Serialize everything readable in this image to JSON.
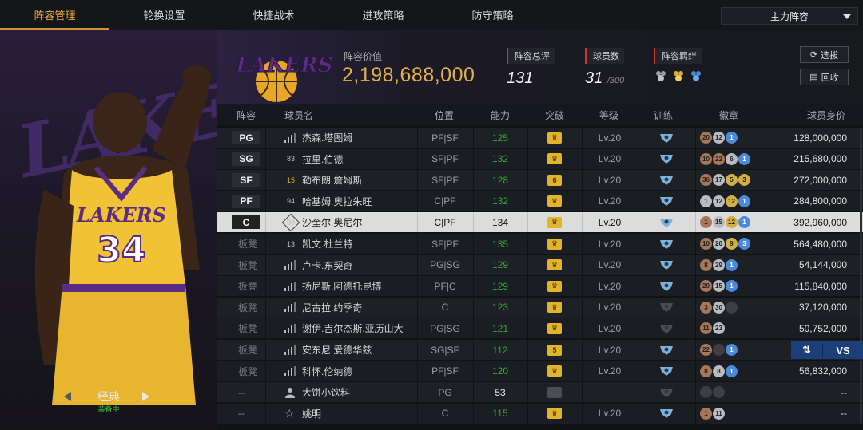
{
  "nav": {
    "tabs": [
      "阵容管理",
      "轮换设置",
      "快捷战术",
      "进攻策略",
      "防守策略"
    ],
    "active_index": 0,
    "lineup_select": "主力阵容"
  },
  "card": {
    "name": "经典",
    "status": "装备中",
    "jersey_team": "LAKERS",
    "jersey_number": "34"
  },
  "summary": {
    "value_label": "阵容价值",
    "value": "2,198,688,000",
    "rating_label": "阵容总评",
    "rating": "131",
    "players_label": "球员数",
    "players": "31",
    "players_max": "/300",
    "bond_label": "阵容羁绊",
    "btn_select": "选拔",
    "btn_recycle": "回收",
    "logo_text": "LAKERS"
  },
  "columns": {
    "lineup": "阵容",
    "name": "球员名",
    "position": "位置",
    "ability": "能力",
    "breakthrough": "突破",
    "level": "等级",
    "training": "训练",
    "badge": "徽章",
    "value": "球员身价"
  },
  "rows": [
    {
      "slot": "PG",
      "icon": "signal",
      "name": "杰森.塔图姆",
      "pos": "PF|SF",
      "ability": "125",
      "crown": "",
      "level": "Lv.20",
      "badges": [
        [
          "b",
          "20"
        ],
        [
          "s",
          "12"
        ],
        [
          "h",
          "1"
        ]
      ],
      "value": "128,000,000"
    },
    {
      "slot": "SG",
      "icon": "83",
      "name": "拉里.伯德",
      "pos": "SF|PF",
      "ability": "132",
      "crown": "",
      "level": "Lv.20",
      "badges": [
        [
          "b",
          "10"
        ],
        [
          "b",
          "22"
        ],
        [
          "s",
          "6"
        ],
        [
          "h",
          "1"
        ]
      ],
      "value": "215,680,000"
    },
    {
      "slot": "SF",
      "icon": "15",
      "name": "勒布朗.詹姆斯",
      "pos": "SF|PF",
      "ability": "128",
      "crown": "6",
      "level": "Lv.20",
      "badges": [
        [
          "b",
          "36"
        ],
        [
          "s",
          "17"
        ],
        [
          "g",
          "5"
        ],
        [
          "g",
          "3"
        ]
      ],
      "value": "272,000,000"
    },
    {
      "slot": "PF",
      "icon": "94",
      "name": "哈基姆.奥拉朱旺",
      "pos": "C|PF",
      "ability": "132",
      "crown": "",
      "level": "Lv.20",
      "badges": [
        [
          "s",
          "1"
        ],
        [
          "s",
          "12"
        ],
        [
          "g",
          "12"
        ],
        [
          "h",
          "1"
        ]
      ],
      "value": "284,800,000"
    },
    {
      "slot": "C",
      "icon": "99",
      "name": "沙奎尔.奥尼尔",
      "pos": "C|PF",
      "ability": "134",
      "crown": "",
      "level": "Lv.20",
      "badges": [
        [
          "b",
          "1"
        ],
        [
          "s",
          "15"
        ],
        [
          "g",
          "12"
        ],
        [
          "h",
          "1"
        ]
      ],
      "value": "392,960,000",
      "selected": true
    },
    {
      "slot": "板凳",
      "icon": "13",
      "name": "凯文.杜兰特",
      "pos": "SF|PF",
      "ability": "135",
      "crown": "",
      "level": "Lv.20",
      "badges": [
        [
          "b",
          "10"
        ],
        [
          "s",
          "20"
        ],
        [
          "g",
          "9"
        ],
        [
          "h",
          "3"
        ]
      ],
      "value": "564,480,000"
    },
    {
      "slot": "板凳",
      "icon": "signal",
      "name": "卢卡.东契奇",
      "pos": "PG|SG",
      "ability": "129",
      "crown": "",
      "level": "Lv.20",
      "badges": [
        [
          "b",
          "8"
        ],
        [
          "s",
          "29"
        ],
        [
          "h",
          "1"
        ]
      ],
      "value": "54,144,000"
    },
    {
      "slot": "板凳",
      "icon": "signal",
      "name": "扬尼斯.阿德托昆博",
      "pos": "PF|C",
      "ability": "129",
      "crown": "",
      "level": "Lv.20",
      "badges": [
        [
          "b",
          "20"
        ],
        [
          "s",
          "15"
        ],
        [
          "h",
          "1"
        ]
      ],
      "value": "115,840,000"
    },
    {
      "slot": "板凳",
      "icon": "signal",
      "name": "尼古拉.约季奇",
      "pos": "C",
      "ability": "123",
      "crown": "",
      "level": "Lv.20",
      "badges": [
        [
          "b",
          "3"
        ],
        [
          "s",
          "30"
        ],
        [
          "e",
          "0"
        ]
      ],
      "value": "37,120,000"
    },
    {
      "slot": "板凳",
      "icon": "signal",
      "name": "谢伊.吉尔杰斯.亚历山大",
      "pos": "PG|SG",
      "ability": "121",
      "crown": "",
      "level": "Lv.20",
      "badges": [
        [
          "b",
          "11"
        ],
        [
          "s",
          "23"
        ]
      ],
      "value": "50,752,000"
    },
    {
      "slot": "板凳",
      "icon": "signal",
      "name": "安东尼.爱德华兹",
      "pos": "SG|SF",
      "ability": "112",
      "crown": "5",
      "level": "Lv.20",
      "badges": [
        [
          "b",
          "22"
        ],
        [
          "e",
          "0"
        ],
        [
          "h",
          "1"
        ]
      ],
      "value": ""
    },
    {
      "slot": "板凳",
      "icon": "signal",
      "name": "科怀.伦纳德",
      "pos": "PF|SF",
      "ability": "120",
      "crown": "",
      "level": "Lv.20",
      "badges": [
        [
          "b",
          "8"
        ],
        [
          "s",
          "8"
        ],
        [
          "h",
          "1"
        ]
      ],
      "value": "56,832,000"
    },
    {
      "slot": "--",
      "icon": "person",
      "name": "大饼小饮料",
      "pos": "PG",
      "ability": "53",
      "crown": "dim",
      "level": "",
      "badges": [
        [
          "e",
          "0"
        ],
        [
          "e",
          "0"
        ]
      ],
      "value": "--"
    },
    {
      "slot": "--",
      "icon": "star",
      "name": "姚明",
      "pos": "C",
      "ability": "115",
      "crown": "",
      "level": "Lv.20",
      "badges": [
        [
          "b",
          "1"
        ],
        [
          "s",
          "11"
        ]
      ],
      "value": "--"
    }
  ],
  "compare": {
    "vs": "VS"
  }
}
